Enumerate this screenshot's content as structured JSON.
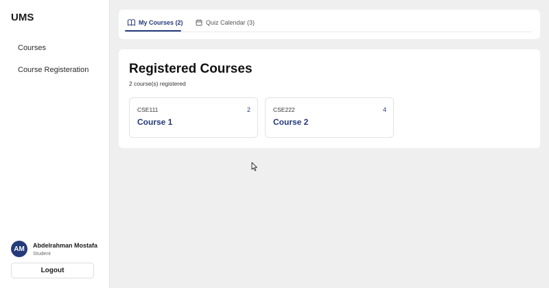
{
  "app": {
    "logo": "UMS"
  },
  "sidebar": {
    "items": [
      {
        "label": "Courses"
      },
      {
        "label": "Course Registeration"
      }
    ]
  },
  "user": {
    "initials": "AM",
    "name": "Abdelrahman Mostafa",
    "role": "Student",
    "logout_label": "Logout"
  },
  "tabs": [
    {
      "label": "My Courses (2)",
      "icon": "book-open-icon",
      "active": true
    },
    {
      "label": "Quiz Calendar (3)",
      "icon": "calendar-icon",
      "active": false
    }
  ],
  "main": {
    "title": "Registered Courses",
    "subtitle": "2 course(s) registered",
    "courses": [
      {
        "code": "CSE111",
        "count": "2",
        "name": "Course 1"
      },
      {
        "code": "CSE222",
        "count": "4",
        "name": "Course 2"
      }
    ]
  },
  "colors": {
    "accent": "#24387a",
    "background": "#efefef",
    "card": "#ffffff"
  }
}
